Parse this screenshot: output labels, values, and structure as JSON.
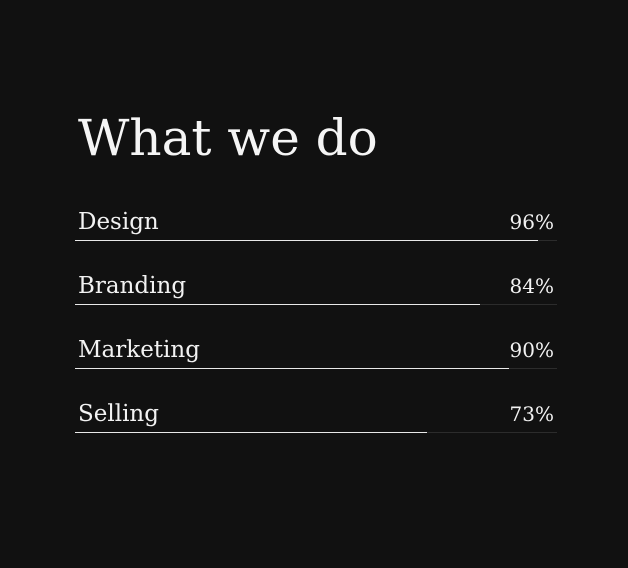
{
  "section": {
    "title": "What we do",
    "skills": [
      {
        "label": "Design",
        "value_text": "96%",
        "percent": 96
      },
      {
        "label": "Branding",
        "value_text": "84%",
        "percent": 84
      },
      {
        "label": "Marketing",
        "value_text": "90%",
        "percent": 90
      },
      {
        "label": "Selling",
        "value_text": "73%",
        "percent": 73
      }
    ]
  },
  "colors": {
    "background": "#111111",
    "text": "#f2f2f2",
    "bar_fill": "#e9e9e9",
    "bar_track": "#2c2c2c"
  }
}
